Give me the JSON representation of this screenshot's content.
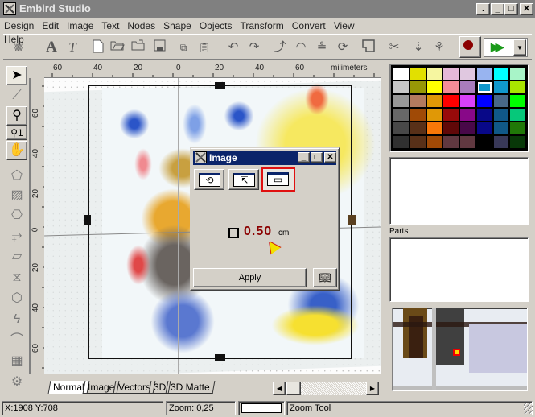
{
  "window": {
    "title": "Embird Studio",
    "icon": "embird-logo-icon",
    "controls": [
      "restore-dot",
      "minimize",
      "maximize",
      "close"
    ]
  },
  "menu": [
    "Design",
    "Edit",
    "Image",
    "Text",
    "Nodes",
    "Shape",
    "Objects",
    "Transform",
    "Convert",
    "View",
    "Help"
  ],
  "toolbar": {
    "icons": [
      "stitch-icon",
      "text-icon",
      "text-on-path-icon",
      "new-file-icon",
      "open-icon",
      "import-icon",
      "save-icon",
      "copy-icon",
      "paste-icon",
      "undo-icon",
      "redo-icon",
      "node-edit-icon",
      "gauge-icon",
      "layers-icon",
      "rotate-select-icon",
      "frame-icon",
      "view-cut-icon",
      "foot-down-icon",
      "branch-icon"
    ],
    "record_button": "record-icon",
    "play_combo": {
      "value": "play-forward",
      "dropdown": "chevron-down-icon"
    }
  },
  "tools": [
    {
      "name": "select-tool",
      "icon": "arrow-pointer-icon",
      "active": true
    },
    {
      "name": "node-tool",
      "icon": "node-arrow-icon"
    },
    {
      "name": "zoom-tool",
      "icon": "magnifier-icon"
    },
    {
      "name": "zoom-1-tool",
      "icon": "magnifier-1-icon",
      "label": "1"
    },
    {
      "name": "pan-tool",
      "icon": "hand-icon"
    },
    {
      "name": "shape-outline-tool",
      "icon": "polygon-outline-icon"
    },
    {
      "name": "fill-tool",
      "icon": "hatched-fill-icon"
    },
    {
      "name": "ring-tool",
      "icon": "ring-icon"
    },
    {
      "name": "satin-tool",
      "icon": "satin-icon"
    },
    {
      "name": "ribbon-tool",
      "icon": "ribbon-icon"
    },
    {
      "name": "twisted-tool",
      "icon": "twisted-fill-icon"
    },
    {
      "name": "polygon-tool",
      "icon": "polygon-icon"
    },
    {
      "name": "zigzag-tool",
      "icon": "zigzag-icon"
    },
    {
      "name": "curve-tool",
      "icon": "curve-icon"
    },
    {
      "name": "lattice-tool",
      "icon": "lattice-icon"
    },
    {
      "name": "gear-tool",
      "icon": "gear-icon"
    }
  ],
  "ruler": {
    "top_labels": [
      "60",
      "40",
      "20",
      "0",
      "20",
      "40",
      "60"
    ],
    "unit": "milimeters",
    "left_labels": [
      "60",
      "40",
      "20",
      "0",
      "20",
      "40",
      "60"
    ]
  },
  "dialog": {
    "title": "Image",
    "mode_buttons": [
      {
        "name": "rotate-mode",
        "icon": "rotate-icon"
      },
      {
        "name": "move-mode",
        "icon": "move-frame-icon"
      },
      {
        "name": "border-mode",
        "icon": "border-frame-icon",
        "selected": true
      }
    ],
    "value": "0.50",
    "unit": "cm",
    "checkbox_checked": false,
    "apply_label": "Apply",
    "help_icon": "book-icon"
  },
  "tabs": [
    {
      "label": "Normal",
      "active": true
    },
    {
      "label": "Image"
    },
    {
      "label": "Vectors"
    },
    {
      "label": "3D"
    },
    {
      "label": "3D Matte"
    }
  ],
  "status": {
    "coords": "X:1908  Y:708",
    "zoom": "Zoom: 0,25",
    "tool": "Zoom Tool"
  },
  "palette": {
    "selected_index": 13,
    "colors": [
      "#ffffff",
      "#e2e000",
      "#f6f6a0",
      "#e6b8d8",
      "#e0c8e0",
      "#98b4f0",
      "#00ffff",
      "#a8f4c8",
      "#c8c8c8",
      "#989806",
      "#ffff00",
      "#f48c98",
      "#a87cbc",
      "#1098cc",
      "#1098cc",
      "#a8e600",
      "#989898",
      "#b47a5e",
      "#e09806",
      "#ff0000",
      "#d840f8",
      "#0000ff",
      "#486888",
      "#00ff00",
      "#686868",
      "#a04a06",
      "#e09806",
      "#980a0a",
      "#880888",
      "#080888",
      "#105888",
      "#06c87a",
      "#484848",
      "#583018",
      "#f87808",
      "#600808",
      "#480848",
      "#080888",
      "#105888",
      "#207808",
      "#303030",
      "#583018",
      "#a04a06",
      "#603840",
      "#603840",
      "#000000",
      "#383858",
      "#083808"
    ]
  },
  "parts_label": "Parts"
}
